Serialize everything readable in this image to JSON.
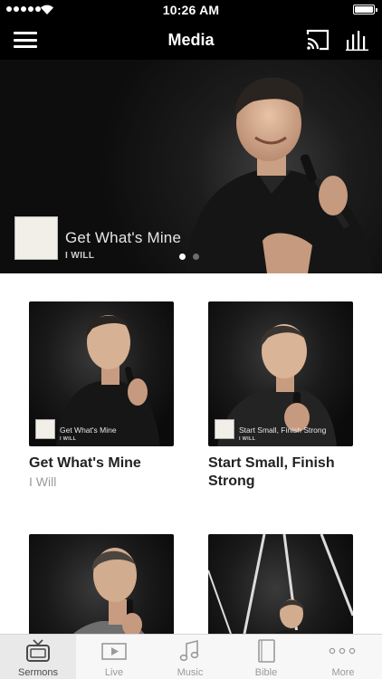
{
  "status_bar": {
    "time": "10:26 AM"
  },
  "nav": {
    "title": "Media"
  },
  "hero": {
    "title": "Get What's Mine",
    "subtitle": "I WILL",
    "pages": 2,
    "active_page": 1
  },
  "cards": [
    {
      "thumb_title": "Get What's Mine",
      "thumb_sub": "I WILL",
      "title": "Get What's Mine",
      "subtitle": "I Will"
    },
    {
      "thumb_title": "Start Small, Finish Strong",
      "thumb_sub": "I WILL",
      "title": "Start Small, Finish Strong",
      "subtitle": ""
    },
    {
      "thumb_title": "",
      "thumb_sub": "",
      "title": "",
      "subtitle": ""
    },
    {
      "thumb_title": "",
      "thumb_sub": "",
      "title": "",
      "subtitle": ""
    }
  ],
  "tabs": [
    {
      "label": "Sermons",
      "icon": "tv-icon",
      "active": true
    },
    {
      "label": "Live",
      "icon": "video-icon",
      "active": false
    },
    {
      "label": "Music",
      "icon": "music-note-icon",
      "active": false
    },
    {
      "label": "Bible",
      "icon": "book-icon",
      "active": false
    },
    {
      "label": "More",
      "icon": "more-dots-icon",
      "active": false
    }
  ],
  "colors": {
    "bar_background": "#000000",
    "tab_active_background": "#e9e9e9",
    "subtitle_gray": "#9b9b9b"
  }
}
